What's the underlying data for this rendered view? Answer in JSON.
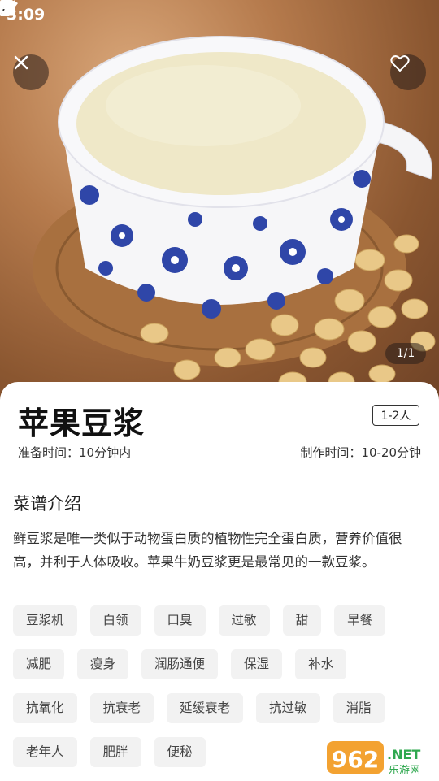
{
  "status_bar": {
    "time": "3:09",
    "left_icons": [
      "download-icon",
      "a-notification-icon"
    ],
    "right_icons": [
      "wifi-icon",
      "signal-icon",
      "battery-charging-icon"
    ]
  },
  "hero": {
    "close_icon": "close-icon",
    "favorite_icon": "heart-icon",
    "page_indicator": "1/1"
  },
  "recipe": {
    "title": "苹果豆浆",
    "servings": "1-2人",
    "prep_time": "准备时间：10分钟内",
    "cook_time": "制作时间：10-20分钟"
  },
  "intro": {
    "heading": "菜谱介绍",
    "text": "鲜豆浆是唯一类似于动物蛋白质的植物性完全蛋白质，营养价值很高，并利于人体吸收。苹果牛奶豆浆更是最常见的一款豆浆。"
  },
  "tags": [
    [
      "豆浆机",
      "白领",
      "口臭",
      "过敏",
      "甜",
      "早餐"
    ],
    [
      "减肥",
      "瘦身",
      "润肠通便",
      "保湿",
      "补水"
    ],
    [
      "抗氧化",
      "抗衰老",
      "延缓衰老",
      "抗过敏",
      "消脂"
    ],
    [
      "老年人",
      "肥胖",
      "便秘"
    ]
  ],
  "watermark": {
    "number": "962",
    "suffix": ".NET",
    "caption": "乐游网"
  },
  "colors": {
    "hero_overlay": "#281e19",
    "tag_bg": "#f2f2f2",
    "soy_milk": "#efe8c8",
    "cup_pattern": "#2f46a8"
  }
}
